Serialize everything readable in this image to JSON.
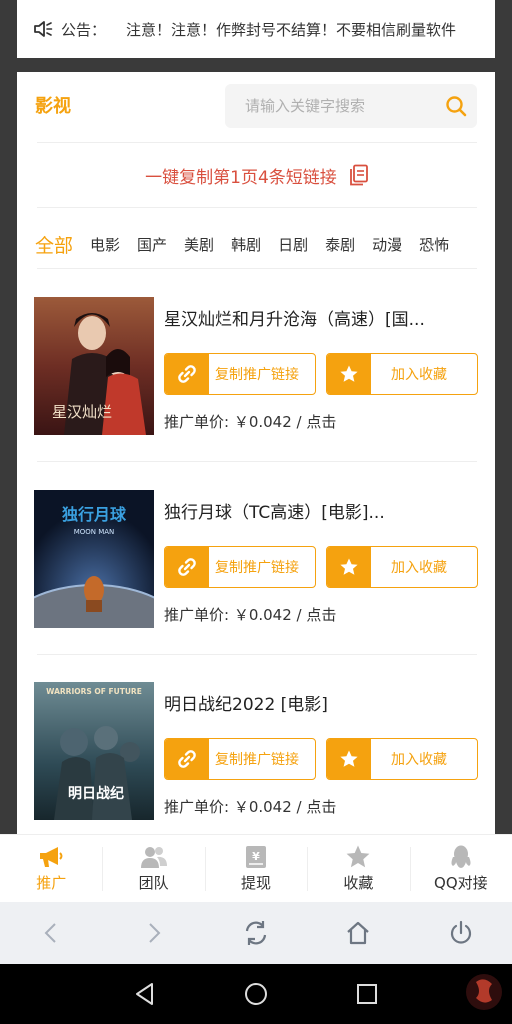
{
  "notice": {
    "label": "公告：",
    "text": "注意！注意！作弊封号不结算！不要相信刷量软件"
  },
  "header": {
    "title": "影视",
    "search_placeholder": "请输入关键字搜索"
  },
  "copy_bar": {
    "label": "一键复制第1页4条短链接"
  },
  "categories": [
    "全部",
    "电影",
    "国产",
    "美剧",
    "韩剧",
    "日剧",
    "泰剧",
    "动漫",
    "恐怖"
  ],
  "items": [
    {
      "title": "星汉灿烂和月升沧海（高速）[国...",
      "copy_label": "复制推广链接",
      "fav_label": "加入收藏",
      "price": "推广单价: ￥0.042 / 点击",
      "poster_text": "星汉灿烂"
    },
    {
      "title": "独行月球（TC高速）[电影]...",
      "copy_label": "复制推广链接",
      "fav_label": "加入收藏",
      "price": "推广单价: ￥0.042 / 点击",
      "poster_text": "独行月球",
      "poster_sub": "MOON MAN"
    },
    {
      "title": "明日战纪2022 [电影]",
      "copy_label": "复制推广链接",
      "fav_label": "加入收藏",
      "price": "推广单价: ￥0.042 / 点击",
      "poster_text": "WARRIORS OF FUTURE",
      "poster_sub": "明日战纪"
    }
  ],
  "tabbar": [
    "推广",
    "团队",
    "提现",
    "收藏",
    "QQ对接"
  ],
  "colors": {
    "accent": "#f5a20f",
    "copy_red": "#d9503f"
  }
}
